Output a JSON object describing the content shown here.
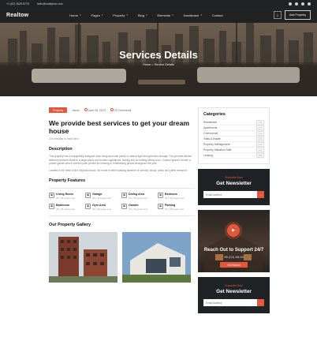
{
  "topbar": {
    "phone": "+1 (62) 3625 8778",
    "email": "hello@realtyhub.com"
  },
  "header": {
    "logo": "Realtow",
    "nav": [
      "Home",
      "Pages",
      "Property",
      "Blog",
      "Elements",
      "Dashboard",
      "Contact"
    ],
    "add_label": "Add Property"
  },
  "hero": {
    "title": "Services Details",
    "breadcrumb": "Home  >  Service Details"
  },
  "post": {
    "tag": "Property",
    "author": "Jacob",
    "date": "June 08, 2023",
    "comments": "05 Comments",
    "title": "We provide best services to get your dream house",
    "read_time": "2-5 minutes to read item",
    "description_heading": "Description",
    "description": "This property has a thoughtfully designed open living area with plenty of natural light and generous storage. The gourmet kitchen features premium finishes, a large island and modern appliances, flowing into an inviting dining room. Outdoor spaces include a private garden and a covered patio perfect for relaxing or entertaining guests throughout the year.",
    "description2": "Located in the heart of the neighbourhood, the home is within walking distance of schools, shops, parks and public transport.",
    "features_heading": "Property Features",
    "features": [
      {
        "icon": "building-icon",
        "title": "Living Room",
        "sub": "45 x 35 square feet"
      },
      {
        "icon": "car-icon",
        "title": "Garage",
        "sub": "45 x 35 square feet"
      },
      {
        "icon": "dining-icon",
        "title": "Dining Area",
        "sub": "45 x 35 square feet"
      },
      {
        "icon": "bed-icon",
        "title": "Bedroom",
        "sub": "45 x 35 square feet"
      },
      {
        "icon": "bath-icon",
        "title": "Bathroom",
        "sub": "45 x 35 square feet"
      },
      {
        "icon": "gym-icon",
        "title": "Gym Area",
        "sub": "45 x 35 square feet"
      },
      {
        "icon": "garden-icon",
        "title": "Garden",
        "sub": "45 x 35 square feet"
      },
      {
        "icon": "parking-icon",
        "title": "Parking",
        "sub": "45 x 35 square feet"
      }
    ],
    "gallery_heading": "Our Property Gallery"
  },
  "sidebar": {
    "categories_heading": "Categories",
    "categories": [
      {
        "label": "Residential",
        "count": "(12)"
      },
      {
        "label": "Apartments",
        "count": "(15)"
      },
      {
        "label": "Commercial",
        "count": "(14)"
      },
      {
        "label": "Villas & Estate",
        "count": "(16)"
      },
      {
        "label": "Property Management",
        "count": "(10)"
      },
      {
        "label": "Property Valuation Sale",
        "count": "(12)"
      },
      {
        "label": "Leasing",
        "count": "(08)"
      }
    ],
    "newsletter": {
      "small": "Subscribe Now",
      "title": "Get Newsletter",
      "placeholder": "Email Address"
    },
    "support": {
      "title": "Reach Out to Support 24/7",
      "phone": "+88 (123) 456 000",
      "button": "Get Started"
    },
    "newsletter2": {
      "small": "Subscribe Now",
      "title": "Get Newsletter",
      "placeholder": "Email Address"
    }
  }
}
